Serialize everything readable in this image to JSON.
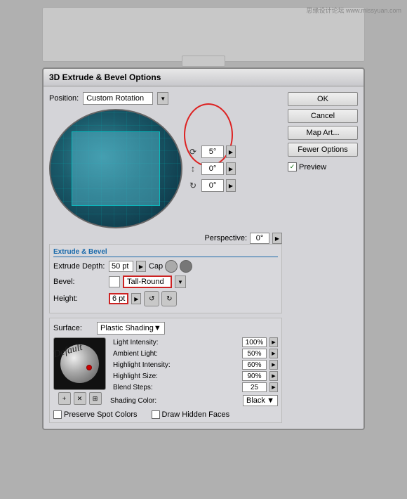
{
  "watermark": "思缘设计论坛 www.missyuan.com",
  "dialog": {
    "title": "3D Extrude & Bevel Options",
    "position_label": "Position:",
    "position_value": "Custom Rotation",
    "rotation": {
      "x": "5°",
      "y": "0°",
      "z": "0°"
    },
    "perspective_label": "Perspective:",
    "perspective_value": "0°",
    "extrude_bevel_label": "Extrude & Bevel",
    "extrude_depth_label": "Extrude Depth:",
    "extrude_depth_value": "50 pt",
    "cap_label": "Cap",
    "bevel_label": "Bevel:",
    "bevel_value": "Tall-Round",
    "height_label": "Height:",
    "height_value": "6 pt",
    "surface_label": "Surface:",
    "surface_value": "Plastic Shading",
    "light_intensity_label": "Light Intensity:",
    "light_intensity_value": "100%",
    "ambient_light_label": "Ambient Light:",
    "ambient_light_value": "50%",
    "highlight_intensity_label": "Highlight Intensity:",
    "highlight_intensity_value": "60%",
    "highlight_size_label": "Highlight Size:",
    "highlight_size_value": "90%",
    "blend_steps_label": "Blend Steps:",
    "blend_steps_value": "25",
    "shading_color_label": "Shading Color:",
    "shading_color_value": "Black",
    "preserve_spot_label": "Preserve Spot Colors",
    "draw_hidden_label": "Draw Hidden Faces",
    "default_label": "Default"
  },
  "buttons": {
    "ok": "OK",
    "cancel": "Cancel",
    "map_art": "Map Art...",
    "fewer_options": "Fewer Options",
    "preview_label": "Preview"
  }
}
